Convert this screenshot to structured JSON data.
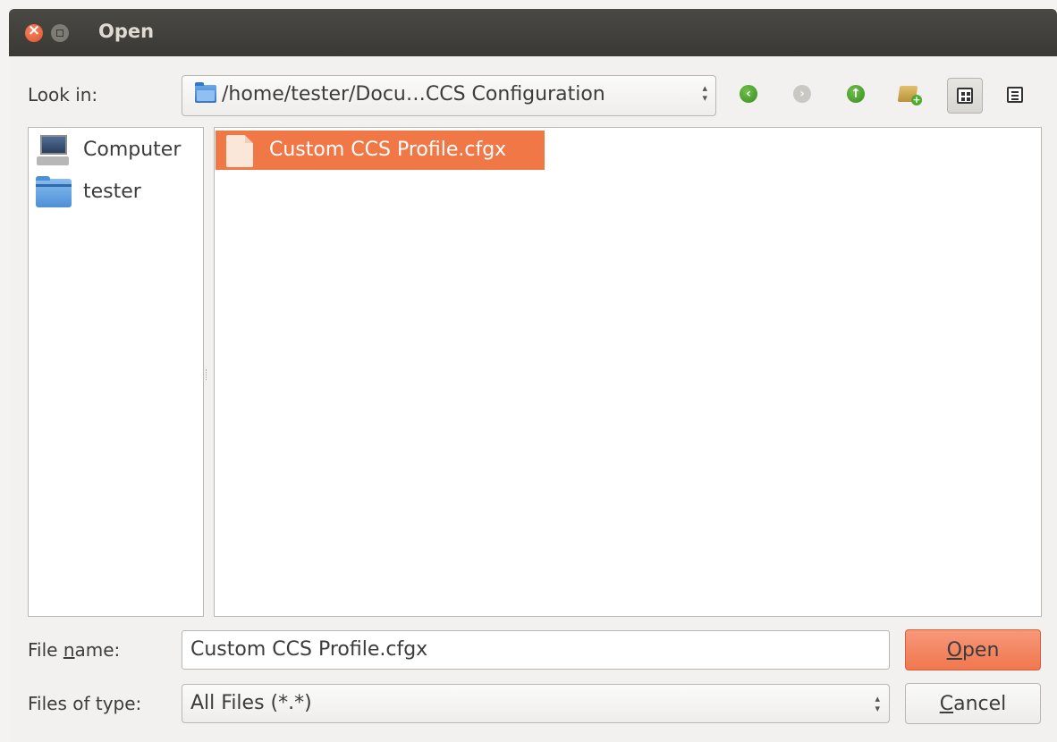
{
  "window": {
    "title": "Open"
  },
  "toolbar": {
    "look_in_label": "Look in:",
    "path_value": "/home/tester/Docu…CCS Configuration",
    "buttons": [
      {
        "name": "back",
        "icon": "back-arrow-icon",
        "enabled": true
      },
      {
        "name": "forward",
        "icon": "forward-arrow-icon",
        "enabled": false
      },
      {
        "name": "parent",
        "icon": "up-arrow-icon",
        "enabled": true
      },
      {
        "name": "new-folder",
        "icon": "new-folder-icon",
        "enabled": true
      },
      {
        "name": "icon-view",
        "icon": "grid-view-icon",
        "active": true
      },
      {
        "name": "detail-view",
        "icon": "list-view-icon",
        "active": false
      }
    ]
  },
  "sidebar": {
    "items": [
      {
        "label": "Computer",
        "icon": "computer-icon"
      },
      {
        "label": "tester",
        "icon": "folder-icon"
      }
    ]
  },
  "files": [
    {
      "name": "Custom CCS Profile.cfgx",
      "icon": "document-icon",
      "selected": true
    }
  ],
  "form": {
    "file_name_label_pre": "File ",
    "file_name_label_mnemonic": "n",
    "file_name_label_post": "ame:",
    "file_name_value": "Custom CCS Profile.cfgx",
    "file_type_label": "Files of type:",
    "file_type_value": "All Files (*.*)"
  },
  "actions": {
    "open_mnemonic": "O",
    "open_rest": "pen",
    "cancel_mnemonic": "C",
    "cancel_rest": "ancel"
  },
  "colors": {
    "titlebar": "#3c3b37",
    "accent": "#f07746",
    "close_button": "#e95420"
  }
}
